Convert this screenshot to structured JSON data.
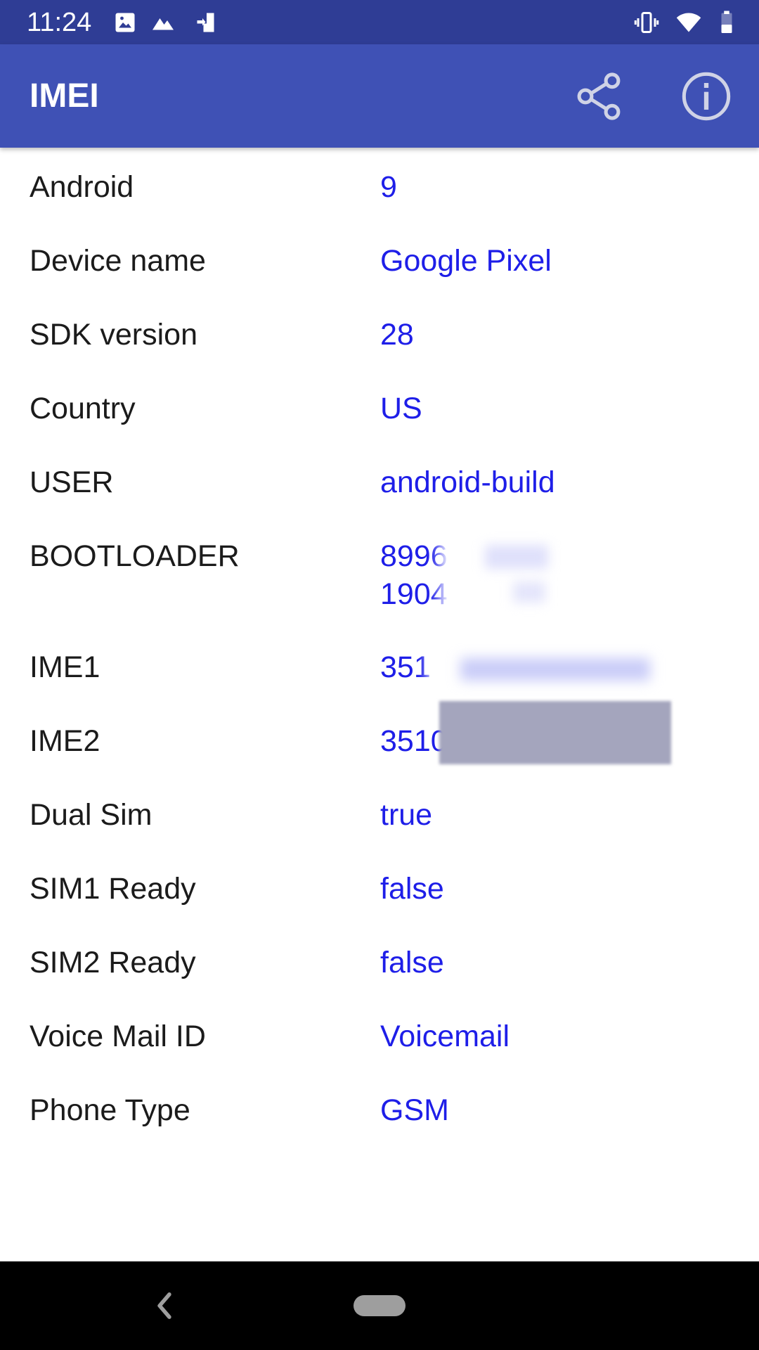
{
  "status_bar": {
    "time": "11:24",
    "left_icons": [
      "image-icon",
      "landscape-icon",
      "sim-transfer-icon"
    ],
    "right_icons": [
      "vibrate-icon",
      "wifi-icon",
      "battery-icon"
    ]
  },
  "app_bar": {
    "title": "IMEI",
    "actions": [
      "share-icon",
      "info-icon"
    ]
  },
  "rows": [
    {
      "label": "Android",
      "value": "9"
    },
    {
      "label": "Device name",
      "value": "Google Pixel"
    },
    {
      "label": "SDK version",
      "value": "28"
    },
    {
      "label": "Country",
      "value": "US"
    },
    {
      "label": "USER",
      "value": "android-build"
    },
    {
      "label": "BOOTLOADER",
      "value": "8996\n1904"
    },
    {
      "label": "IME1",
      "value": "351"
    },
    {
      "label": "IME2",
      "value": "3510"
    },
    {
      "label": "Dual Sim",
      "value": "true"
    },
    {
      "label": "SIM1 Ready",
      "value": "false"
    },
    {
      "label": "SIM2 Ready",
      "value": "false"
    },
    {
      "label": "Voice Mail ID",
      "value": "Voicemail"
    },
    {
      "label": "Phone Type",
      "value": "GSM"
    }
  ],
  "colors": {
    "status_bar": "#2f3d95",
    "app_bar": "#3f51b5",
    "label_text": "#1b1b1b",
    "value_text": "#1e1ee8",
    "nav_bar": "#000000"
  },
  "nav_bar": {
    "buttons": [
      "back-icon",
      "home-pill"
    ]
  }
}
